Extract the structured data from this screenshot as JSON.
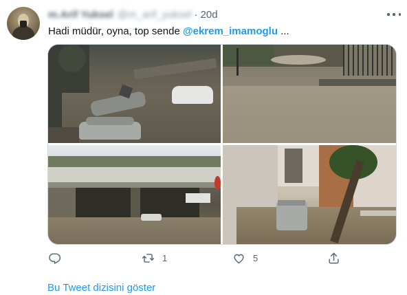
{
  "author": {
    "display_name": "m.Arif Yuksel",
    "handle": "@m_arif_yuksel",
    "separator": "·",
    "time": "20d"
  },
  "tweet": {
    "text": "Hadi müdür, oyna, top sende ",
    "mention": "@ekrem_imamoglu",
    "ellipsis": " ..."
  },
  "actions": {
    "reply_count": "",
    "retweet_count": "1",
    "like_count": "5"
  },
  "show_thread_label": "Bu Tweet dizisini göster",
  "colors": {
    "accent": "#1d9bf0",
    "secondary_text": "#536471",
    "border": "#cfd9de"
  },
  "icons": {
    "reply": "reply-icon",
    "retweet": "retweet-icon",
    "like": "heart-icon",
    "share": "share-icon",
    "more": "more-icon"
  }
}
